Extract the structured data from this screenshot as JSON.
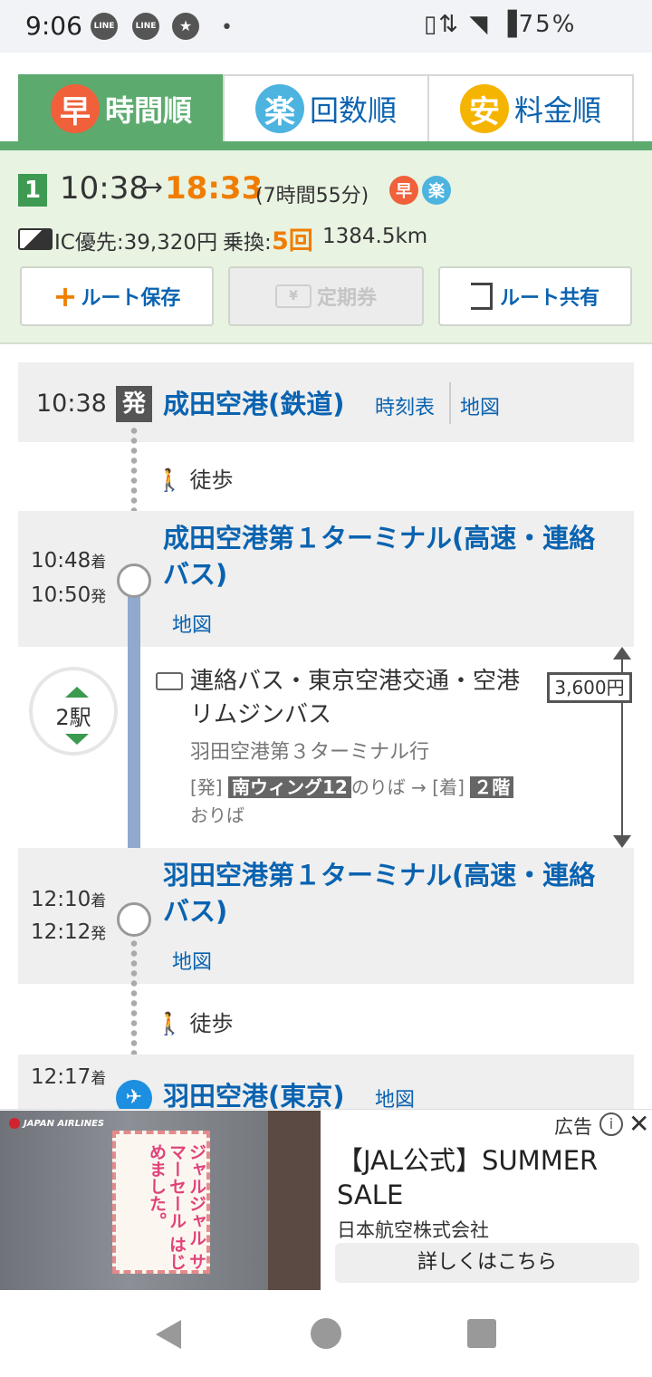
{
  "status_bar": {
    "time": "9:06",
    "app_icons": [
      "LINE",
      "LINE"
    ],
    "right": "75%"
  },
  "tabs": [
    {
      "badge": "早",
      "label": "時間順",
      "badge_color": "#f0603a",
      "active": true
    },
    {
      "badge": "楽",
      "label": "回数順",
      "badge_color": "#4db3df",
      "active": false
    },
    {
      "badge": "安",
      "label": "料金順",
      "badge_color": "#f4b400",
      "active": false
    }
  ],
  "summary": {
    "route_no": "1",
    "depart": "10:38",
    "arrow": "→",
    "arrive": "18:33",
    "duration": "(7時間55分)",
    "badges": [
      "早",
      "楽"
    ],
    "ic": "IC優先:39,320円",
    "transfers_label": "乗換:",
    "transfers_value": "5回",
    "distance": "1384.5km"
  },
  "actions": {
    "save": "ルート保存",
    "commuter": "定期券",
    "share": "ルート共有"
  },
  "route": {
    "start": {
      "time": "10:38",
      "mark": "発",
      "name": "成田空港(鉄道)",
      "timetable": "時刻表",
      "map": "地図"
    },
    "walk1": "徒歩",
    "stop1": {
      "arr": "10:48",
      "arr_suffix": "着",
      "dep": "10:50",
      "dep_suffix": "発",
      "name": "成田空港第１ターミナル(高速・連絡バス)",
      "map": "地図"
    },
    "bus": {
      "stops": "2駅",
      "name": "連絡バス・東京空港交通・空港リムジンバス",
      "dest": "羽田空港第３ターミナル行",
      "dep_tag": "[発]",
      "dep_platform": "南ウィング12",
      "dep_platform_suffix": "のりば",
      "arrow": "→",
      "arr_tag": "[着]",
      "arr_platform": "２階",
      "arr_platform_suffix": "おりば",
      "fare": "3,600円"
    },
    "stop2": {
      "arr": "12:10",
      "arr_suffix": "着",
      "dep": "12:12",
      "dep_suffix": "発",
      "name": "羽田空港第１ターミナル(高速・連絡バス)",
      "map": "地図"
    },
    "walk2": "徒歩",
    "stop3": {
      "arr": "12:17",
      "arr_suffix": "着",
      "name": "羽田空港(東京)",
      "map": "地図"
    }
  },
  "ad": {
    "label": "広告",
    "image_brand": "JAPAN AIRLINES",
    "image_text": "ジャルジャル サマーセール はじめました。",
    "title": "【JAL公式】SUMMER SALE",
    "company": "日本航空株式会社",
    "cta": "詳しくはこちら"
  }
}
